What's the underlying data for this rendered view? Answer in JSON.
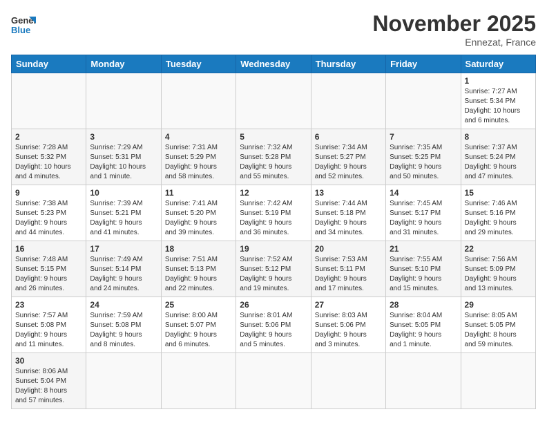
{
  "logo": {
    "general": "General",
    "blue": "Blue"
  },
  "title": "November 2025",
  "location": "Ennezat, France",
  "weekdays": [
    "Sunday",
    "Monday",
    "Tuesday",
    "Wednesday",
    "Thursday",
    "Friday",
    "Saturday"
  ],
  "weeks": [
    [
      {
        "day": "",
        "info": ""
      },
      {
        "day": "",
        "info": ""
      },
      {
        "day": "",
        "info": ""
      },
      {
        "day": "",
        "info": ""
      },
      {
        "day": "",
        "info": ""
      },
      {
        "day": "",
        "info": ""
      },
      {
        "day": "1",
        "info": "Sunrise: 7:27 AM\nSunset: 5:34 PM\nDaylight: 10 hours\nand 6 minutes."
      }
    ],
    [
      {
        "day": "2",
        "info": "Sunrise: 7:28 AM\nSunset: 5:32 PM\nDaylight: 10 hours\nand 4 minutes."
      },
      {
        "day": "3",
        "info": "Sunrise: 7:29 AM\nSunset: 5:31 PM\nDaylight: 10 hours\nand 1 minute."
      },
      {
        "day": "4",
        "info": "Sunrise: 7:31 AM\nSunset: 5:29 PM\nDaylight: 9 hours\nand 58 minutes."
      },
      {
        "day": "5",
        "info": "Sunrise: 7:32 AM\nSunset: 5:28 PM\nDaylight: 9 hours\nand 55 minutes."
      },
      {
        "day": "6",
        "info": "Sunrise: 7:34 AM\nSunset: 5:27 PM\nDaylight: 9 hours\nand 52 minutes."
      },
      {
        "day": "7",
        "info": "Sunrise: 7:35 AM\nSunset: 5:25 PM\nDaylight: 9 hours\nand 50 minutes."
      },
      {
        "day": "8",
        "info": "Sunrise: 7:37 AM\nSunset: 5:24 PM\nDaylight: 9 hours\nand 47 minutes."
      }
    ],
    [
      {
        "day": "9",
        "info": "Sunrise: 7:38 AM\nSunset: 5:23 PM\nDaylight: 9 hours\nand 44 minutes."
      },
      {
        "day": "10",
        "info": "Sunrise: 7:39 AM\nSunset: 5:21 PM\nDaylight: 9 hours\nand 41 minutes."
      },
      {
        "day": "11",
        "info": "Sunrise: 7:41 AM\nSunset: 5:20 PM\nDaylight: 9 hours\nand 39 minutes."
      },
      {
        "day": "12",
        "info": "Sunrise: 7:42 AM\nSunset: 5:19 PM\nDaylight: 9 hours\nand 36 minutes."
      },
      {
        "day": "13",
        "info": "Sunrise: 7:44 AM\nSunset: 5:18 PM\nDaylight: 9 hours\nand 34 minutes."
      },
      {
        "day": "14",
        "info": "Sunrise: 7:45 AM\nSunset: 5:17 PM\nDaylight: 9 hours\nand 31 minutes."
      },
      {
        "day": "15",
        "info": "Sunrise: 7:46 AM\nSunset: 5:16 PM\nDaylight: 9 hours\nand 29 minutes."
      }
    ],
    [
      {
        "day": "16",
        "info": "Sunrise: 7:48 AM\nSunset: 5:15 PM\nDaylight: 9 hours\nand 26 minutes."
      },
      {
        "day": "17",
        "info": "Sunrise: 7:49 AM\nSunset: 5:14 PM\nDaylight: 9 hours\nand 24 minutes."
      },
      {
        "day": "18",
        "info": "Sunrise: 7:51 AM\nSunset: 5:13 PM\nDaylight: 9 hours\nand 22 minutes."
      },
      {
        "day": "19",
        "info": "Sunrise: 7:52 AM\nSunset: 5:12 PM\nDaylight: 9 hours\nand 19 minutes."
      },
      {
        "day": "20",
        "info": "Sunrise: 7:53 AM\nSunset: 5:11 PM\nDaylight: 9 hours\nand 17 minutes."
      },
      {
        "day": "21",
        "info": "Sunrise: 7:55 AM\nSunset: 5:10 PM\nDaylight: 9 hours\nand 15 minutes."
      },
      {
        "day": "22",
        "info": "Sunrise: 7:56 AM\nSunset: 5:09 PM\nDaylight: 9 hours\nand 13 minutes."
      }
    ],
    [
      {
        "day": "23",
        "info": "Sunrise: 7:57 AM\nSunset: 5:08 PM\nDaylight: 9 hours\nand 11 minutes."
      },
      {
        "day": "24",
        "info": "Sunrise: 7:59 AM\nSunset: 5:08 PM\nDaylight: 9 hours\nand 8 minutes."
      },
      {
        "day": "25",
        "info": "Sunrise: 8:00 AM\nSunset: 5:07 PM\nDaylight: 9 hours\nand 6 minutes."
      },
      {
        "day": "26",
        "info": "Sunrise: 8:01 AM\nSunset: 5:06 PM\nDaylight: 9 hours\nand 5 minutes."
      },
      {
        "day": "27",
        "info": "Sunrise: 8:03 AM\nSunset: 5:06 PM\nDaylight: 9 hours\nand 3 minutes."
      },
      {
        "day": "28",
        "info": "Sunrise: 8:04 AM\nSunset: 5:05 PM\nDaylight: 9 hours\nand 1 minute."
      },
      {
        "day": "29",
        "info": "Sunrise: 8:05 AM\nSunset: 5:05 PM\nDaylight: 8 hours\nand 59 minutes."
      }
    ],
    [
      {
        "day": "30",
        "info": "Sunrise: 8:06 AM\nSunset: 5:04 PM\nDaylight: 8 hours\nand 57 minutes."
      },
      {
        "day": "",
        "info": ""
      },
      {
        "day": "",
        "info": ""
      },
      {
        "day": "",
        "info": ""
      },
      {
        "day": "",
        "info": ""
      },
      {
        "day": "",
        "info": ""
      },
      {
        "day": "",
        "info": ""
      }
    ]
  ]
}
